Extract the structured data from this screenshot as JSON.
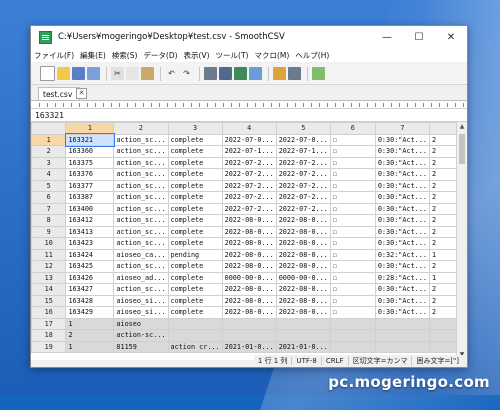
{
  "window": {
    "title": "C:¥Users¥mogeringo¥Desktop¥test.csv - SmoothCSV",
    "minimize": "—",
    "maximize": "☐",
    "close": "✕"
  },
  "menu": [
    "ファイル(F)",
    "編集(E)",
    "検索(S)",
    "データ(D)",
    "表示(V)",
    "ツール(T)",
    "マクロ(M)",
    "ヘルプ(H)"
  ],
  "tab": {
    "label": "test.csv",
    "close": "✕"
  },
  "cell_value": "163321",
  "grid": {
    "columns": [
      "1",
      "2",
      "3",
      "4",
      "5",
      "6",
      "7",
      ""
    ],
    "rows": [
      {
        "num": "1",
        "cells": [
          "163321",
          "action_sc...",
          "complete",
          "2022-07-0...",
          "2022-07-0...",
          "☐",
          "0:30:\"Act...",
          "2"
        ]
      },
      {
        "num": "2",
        "cells": [
          "163360",
          "action_sc...",
          "complete",
          "2022-07-1...",
          "2022-07-1...",
          "☐",
          "0:30:\"Act...",
          "2"
        ]
      },
      {
        "num": "3",
        "cells": [
          "163375",
          "action_sc...",
          "complete",
          "2022-07-2...",
          "2022-07-2...",
          "☐",
          "0:30:\"Act...",
          "2"
        ]
      },
      {
        "num": "4",
        "cells": [
          "163376",
          "action_sc...",
          "complete",
          "2022-07-2...",
          "2022-07-2...",
          "☐",
          "0:30:\"Act...",
          "2"
        ]
      },
      {
        "num": "5",
        "cells": [
          "163377",
          "action_sc...",
          "complete",
          "2022-07-2...",
          "2022-07-2...",
          "☐",
          "0:30:\"Act...",
          "2"
        ]
      },
      {
        "num": "6",
        "cells": [
          "163387",
          "action_sc...",
          "complete",
          "2022-07-2...",
          "2022-07-2...",
          "☐",
          "0:30:\"Act...",
          "2"
        ]
      },
      {
        "num": "7",
        "cells": [
          "163400",
          "action_sc...",
          "complete",
          "2022-07-2...",
          "2022-07-2...",
          "☐",
          "0:30:\"Act...",
          "2"
        ]
      },
      {
        "num": "8",
        "cells": [
          "163412",
          "action_sc...",
          "complete",
          "2022-08-0...",
          "2022-08-0...",
          "☐",
          "0:30:\"Act...",
          "2"
        ]
      },
      {
        "num": "9",
        "cells": [
          "163413",
          "action_sc...",
          "complete",
          "2022-08-0...",
          "2022-08-0...",
          "☐",
          "0:30:\"Act...",
          "2"
        ]
      },
      {
        "num": "10",
        "cells": [
          "163423",
          "action_sc...",
          "complete",
          "2022-08-0...",
          "2022-08-0...",
          "☐",
          "0:30:\"Act...",
          "2"
        ]
      },
      {
        "num": "11",
        "cells": [
          "163424",
          "aioseo_ca...",
          "pending",
          "2022-08-0...",
          "2022-08-0...",
          "☐",
          "0:32:\"Act...",
          "1"
        ]
      },
      {
        "num": "12",
        "cells": [
          "163425",
          "action_sc...",
          "complete",
          "2022-08-0...",
          "2022-08-0...",
          "☐",
          "0:30:\"Act...",
          "2"
        ]
      },
      {
        "num": "13",
        "cells": [
          "163426",
          "aioseo_ad...",
          "complete",
          "0000-00-0...",
          "0000-00-0...",
          "☐",
          "0:28:\"Act...",
          "1"
        ]
      },
      {
        "num": "14",
        "cells": [
          "163427",
          "action_sc...",
          "complete",
          "2022-08-0...",
          "2022-08-0...",
          "☐",
          "0:30:\"Act...",
          "2"
        ]
      },
      {
        "num": "15",
        "cells": [
          "163428",
          "aioseo_si...",
          "complete",
          "2022-08-0...",
          "2022-08-0...",
          "☐",
          "0:30:\"Act...",
          "2"
        ]
      },
      {
        "num": "16",
        "cells": [
          "163429",
          "aioseo_si...",
          "complete",
          "2022-08-0...",
          "2022-08-0...",
          "☐",
          "0:30:\"Act...",
          "2"
        ]
      },
      {
        "num": "17",
        "cells": [
          "1",
          "aioseo",
          "",
          "",
          "",
          "",
          "",
          ""
        ]
      },
      {
        "num": "18",
        "cells": [
          "2",
          "action-sc...",
          "",
          "",
          "",
          "",
          "",
          ""
        ]
      },
      {
        "num": "19",
        "cells": [
          "1",
          "81159",
          "action cr...",
          "2021-01-0...",
          "2021-01-0...",
          "",
          "",
          ""
        ]
      }
    ]
  },
  "status": {
    "position": "1 行 1 列",
    "encoding": "UTF-8",
    "newline": "CRLF",
    "delimiter": "区切文字=カンマ",
    "quote": "囲み文字=[\"]"
  },
  "watermark": "pc.mogeringo.com"
}
